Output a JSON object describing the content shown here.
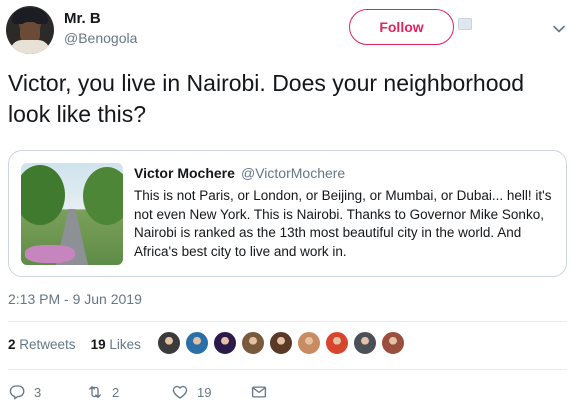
{
  "author": {
    "name": "Mr. B",
    "handle": "@Benogola"
  },
  "follow_button": {
    "label": "Follow"
  },
  "tweet": {
    "text": "Victor, you live in Nairobi. Does your neighborhood look like this?",
    "timestamp": "2:13 PM - 9 Jun 2019"
  },
  "quoted_tweet": {
    "name": "Victor Mochere",
    "handle": "@VictorMochere",
    "text": "This is not Paris, or London, or Beijing, or Mumbai, or Dubai... hell! it's not even New York. This is Nairobi. Thanks to Governor Mike Sonko, Nairobi is ranked as the 13th most beautiful city in the world. And Africa's best city to live and work in."
  },
  "stats": {
    "retweets_count": "2",
    "retweets_label": "Retweets",
    "likes_count": "19",
    "likes_label": "Likes"
  },
  "likers": [
    {
      "color": "#3b3b3b"
    },
    {
      "color": "#2a6fa8"
    },
    {
      "color": "#2b1a4a"
    },
    {
      "color": "#7a5a3c"
    },
    {
      "color": "#5a3a26"
    },
    {
      "color": "#c98b62"
    },
    {
      "color": "#d8452f"
    },
    {
      "color": "#4b4f57"
    },
    {
      "color": "#9a4e3d"
    }
  ],
  "actions": {
    "reply_count": "3",
    "retweet_count": "2",
    "like_count": "19"
  },
  "colors": {
    "follow_accent": "#e0245e",
    "secondary_text": "#657786",
    "border": "#ccd6dd"
  }
}
